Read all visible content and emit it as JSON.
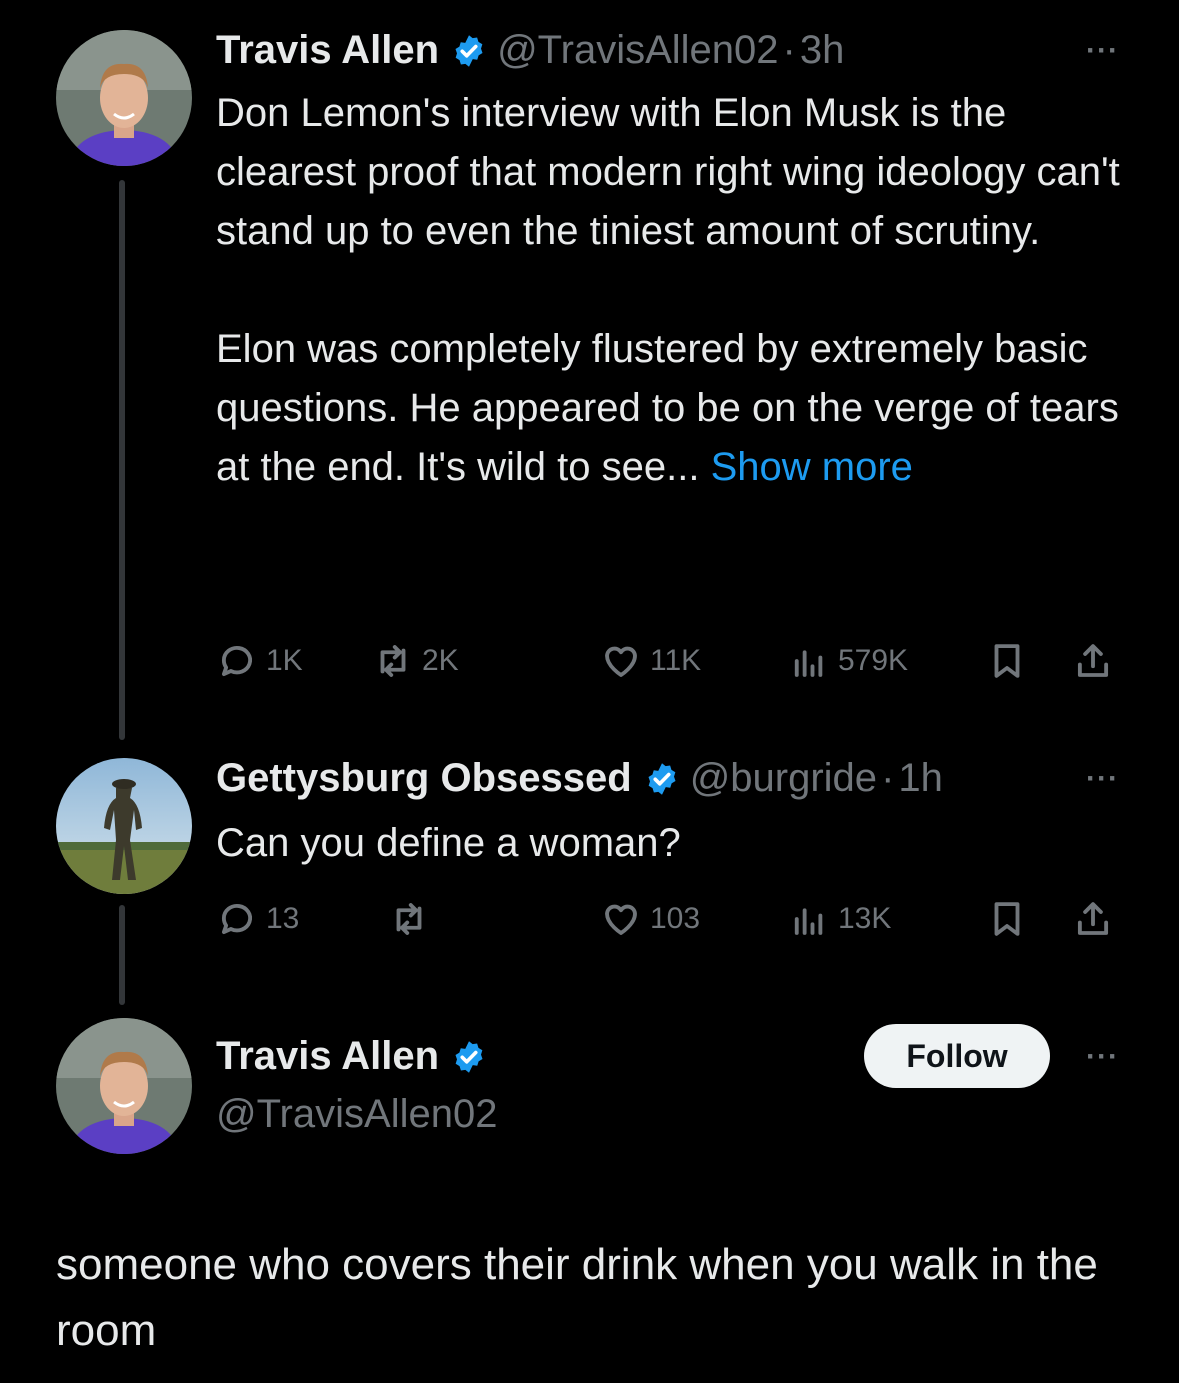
{
  "tweet1": {
    "name": "Travis Allen",
    "handle": "@TravisAllen02",
    "dot": "·",
    "time": "3h",
    "more": "···",
    "p1": "Don Lemon's interview with Elon Musk is the clearest proof that modern right wing ideology can't stand up to even the tiniest amount of scrutiny.",
    "p2": "Elon was completely flustered by extremely basic questions. He appeared to be on the verge of tears at the end. It's wild to see...",
    "show_more": "Show more",
    "replies": "1K",
    "reposts": "2K",
    "likes": "11K",
    "views": "579K"
  },
  "tweet2": {
    "name": "Gettysburg Obsessed",
    "handle": "@burgride",
    "dot": "·",
    "time": "1h",
    "more": "···",
    "text": "Can you define a woman?",
    "replies": "13",
    "reposts": "",
    "likes": "103",
    "views": "13K"
  },
  "profile": {
    "name": "Travis Allen",
    "handle": "@TravisAllen02",
    "follow_label": "Follow",
    "more": "···"
  },
  "reply": {
    "text": "someone who covers their drink when you walk in the room"
  },
  "colors": {
    "background": "#000000",
    "text": "#e7e9ea",
    "muted": "#71767b",
    "link": "#1d9bf0",
    "verified": "#1d9bf0"
  }
}
